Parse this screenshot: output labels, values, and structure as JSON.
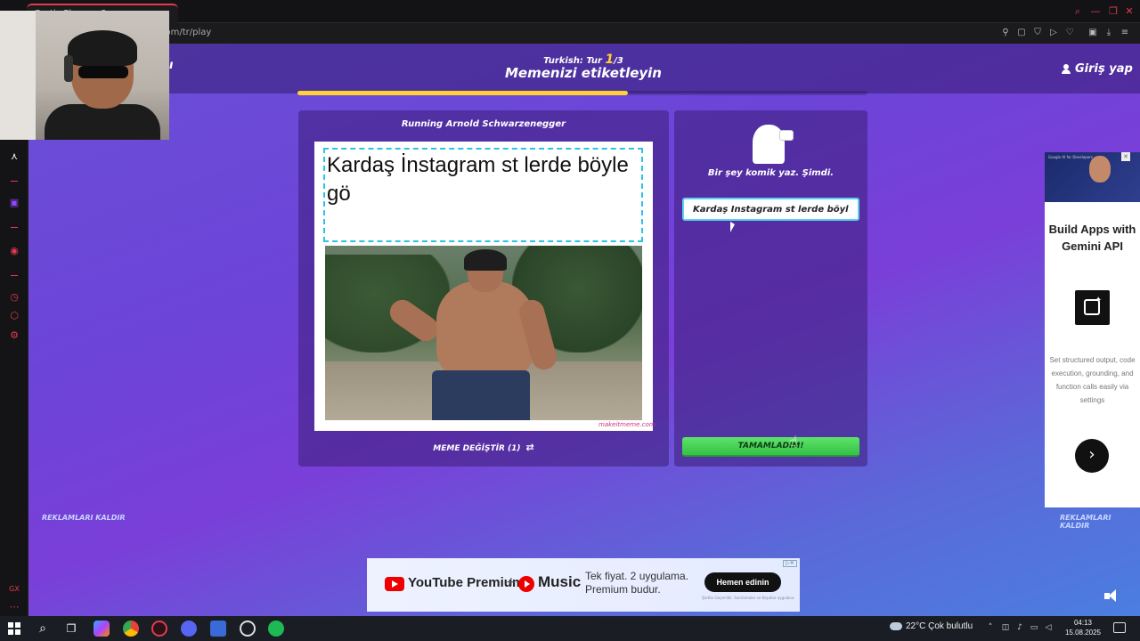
{
  "browser": {
    "tab_title": "Gartic Phone - Oyun",
    "url": "com/tr/play",
    "accent_color": "#e23a4f"
  },
  "game": {
    "round_prefix": "Turkish: Tur ",
    "round_current": "1",
    "round_suffix": "/3",
    "title": "Memenizi etiketleyin",
    "progress": 0.58,
    "login_label": "Giriş yap",
    "header_left_glyph": "ı",
    "meme_name": "Running Arnold Schwarzenegger",
    "caption_text": "Kardaş İnstagram st lerde böyle gö",
    "watermark": "makeitmeme.com",
    "change_meme_label": "MEME DEĞİŞTİR (1)",
    "prompt": "Bir şey komik yaz. Şimdi.",
    "input_value": "Kardaş İnstagram st lerde böyle gö",
    "done_label": "TAMAMLADIM!",
    "remove_ads_left": "REKLAMLARI KALDIR",
    "remove_ads_right": "REKLAMLARI KALDIR",
    "accent_yellow": "#ffd230",
    "done_color": "#4fd85c"
  },
  "side_ad": {
    "thumb_text": "Google AI for Developers",
    "headline": "Build Apps with Gemini API",
    "body": "Set structured output, code execution, grounding, and function calls easily via settings",
    "next_icon": "chevron-right-icon"
  },
  "bottom_ad": {
    "brand1": "YouTube Premium",
    "plus": "+",
    "brand2": "Music",
    "tagline_line1": "Tek fiyat. 2 uygulama.",
    "tagline_line2": "Premium budur.",
    "cta": "Hemen edinin",
    "fine_print": "Şartlar Geçerlidir. Sınırlamalar ve Koşullar uygulanır."
  },
  "taskbar": {
    "weather": "22°C  Çok bulutlu",
    "time": "04:13",
    "date": "15.08.2025"
  }
}
